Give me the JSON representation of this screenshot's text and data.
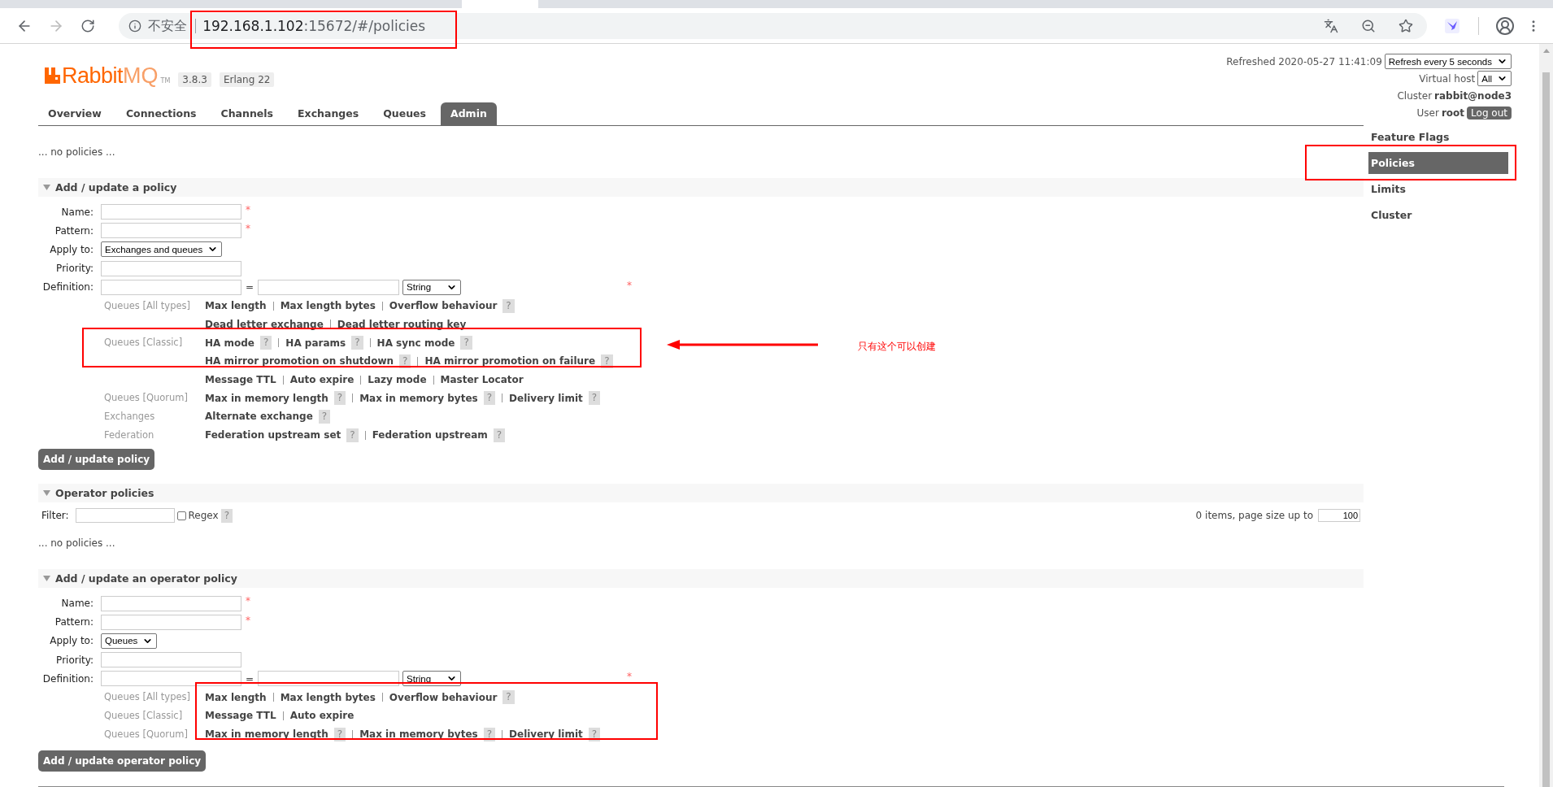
{
  "browser": {
    "address_bar": {
      "security_label": "不安全",
      "host": "192.168.1.102",
      "path": ":15672/#/policies"
    }
  },
  "header": {
    "logo": {
      "name": "Rabbit",
      "suffix": "MQ",
      "tm": "TM"
    },
    "version": "3.8.3",
    "erlang": "Erlang 22",
    "refreshed": "Refreshed 2020-05-27 11:41:09",
    "refresh_select": "Refresh every 5 seconds",
    "vhost_label": "Virtual host",
    "vhost_value": "All",
    "cluster_label": "Cluster",
    "cluster_value": "rabbit@node3",
    "user_label": "User",
    "user_value": "root",
    "logout": "Log out"
  },
  "tabs": [
    {
      "label": "Overview",
      "selected": false
    },
    {
      "label": "Connections",
      "selected": false
    },
    {
      "label": "Channels",
      "selected": false
    },
    {
      "label": "Exchanges",
      "selected": false
    },
    {
      "label": "Queues",
      "selected": false
    },
    {
      "label": "Admin",
      "selected": true
    }
  ],
  "sidebar": {
    "items": [
      {
        "label": "Feature Flags",
        "selected": false
      },
      {
        "label": "Policies",
        "selected": true
      },
      {
        "label": "Limits",
        "selected": false
      },
      {
        "label": "Cluster",
        "selected": false
      }
    ]
  },
  "policies_empty": "... no policies ...",
  "policy_form": {
    "title": "Add / update a policy",
    "fields": [
      {
        "label": "Name:",
        "kind": "text",
        "required_mark": "*"
      },
      {
        "label": "Pattern:",
        "kind": "text",
        "required_mark": "*"
      },
      {
        "label": "Apply to:",
        "kind": "select",
        "value": "Exchanges and queues"
      },
      {
        "label": "Priority:",
        "kind": "text"
      },
      {
        "label": "Definition:",
        "kind": "definition",
        "equals": "=",
        "type_value": "String",
        "required_mark": "*"
      }
    ],
    "option_groups": [
      {
        "label": "Queues [All types]",
        "lines": [
          [
            {
              "text": "Max length"
            },
            {
              "text": "Max length bytes"
            },
            {
              "text": "Overflow behaviour",
              "help": "?"
            }
          ],
          [
            {
              "text": "Dead letter exchange"
            },
            {
              "text": "Dead letter routing key"
            }
          ]
        ]
      },
      {
        "label": "Queues [Classic]",
        "lines": [
          [
            {
              "text": "HA mode",
              "help": "?"
            },
            {
              "text": "HA params",
              "help": "?"
            },
            {
              "text": "HA sync mode",
              "help": "?"
            }
          ],
          [
            {
              "text": "HA mirror promotion on shutdown",
              "help": "?"
            },
            {
              "text": "HA mirror promotion on failure",
              "help": "?"
            }
          ],
          [
            {
              "text": "Message TTL"
            },
            {
              "text": "Auto expire"
            },
            {
              "text": "Lazy mode"
            },
            {
              "text": "Master Locator"
            }
          ]
        ]
      },
      {
        "label": "Queues [Quorum]",
        "lines": [
          [
            {
              "text": "Max in memory length",
              "help": "?"
            },
            {
              "text": "Max in memory bytes",
              "help": "?"
            },
            {
              "text": "Delivery limit",
              "help": "?"
            }
          ]
        ]
      },
      {
        "label": "Exchanges",
        "lines": [
          [
            {
              "text": "Alternate exchange",
              "help": "?"
            }
          ]
        ]
      },
      {
        "label": "Federation",
        "lines": [
          [
            {
              "text": "Federation upstream set",
              "help": "?"
            },
            {
              "text": "Federation upstream",
              "help": "?"
            }
          ]
        ]
      }
    ],
    "button": "Add / update policy"
  },
  "operator_policies": {
    "title": "Operator policies",
    "filter_label": "Filter:",
    "regex": {
      "label": "Regex",
      "checked": false,
      "help": "?"
    },
    "pagination": "0 items, page size up to",
    "page_size": "100",
    "empty": "... no policies ..."
  },
  "operator_form": {
    "title": "Add / update an operator policy",
    "fields": [
      {
        "label": "Name:",
        "kind": "text",
        "required_mark": "*"
      },
      {
        "label": "Pattern:",
        "kind": "text",
        "required_mark": "*"
      },
      {
        "label": "Apply to:",
        "kind": "select",
        "value": "Queues"
      },
      {
        "label": "Priority:",
        "kind": "text"
      },
      {
        "label": "Definition:",
        "kind": "definition",
        "equals": "=",
        "type_value": "String",
        "required_mark": "*"
      }
    ],
    "option_groups": [
      {
        "label": "Queues [All types]",
        "lines": [
          [
            {
              "text": "Max length"
            },
            {
              "text": "Max length bytes"
            },
            {
              "text": "Overflow behaviour",
              "help": "?"
            }
          ]
        ]
      },
      {
        "label": "Queues [Classic]",
        "lines": [
          [
            {
              "text": "Message TTL"
            },
            {
              "text": "Auto expire"
            }
          ]
        ]
      },
      {
        "label": "Queues [Quorum]",
        "lines": [
          [
            {
              "text": "Max in memory length",
              "help": "?"
            },
            {
              "text": "Max in memory bytes",
              "help": "?"
            },
            {
              "text": "Delivery limit",
              "help": "?"
            }
          ]
        ]
      }
    ],
    "button": "Add / update operator policy"
  },
  "annotation": {
    "note": "只有这个可以创建"
  }
}
